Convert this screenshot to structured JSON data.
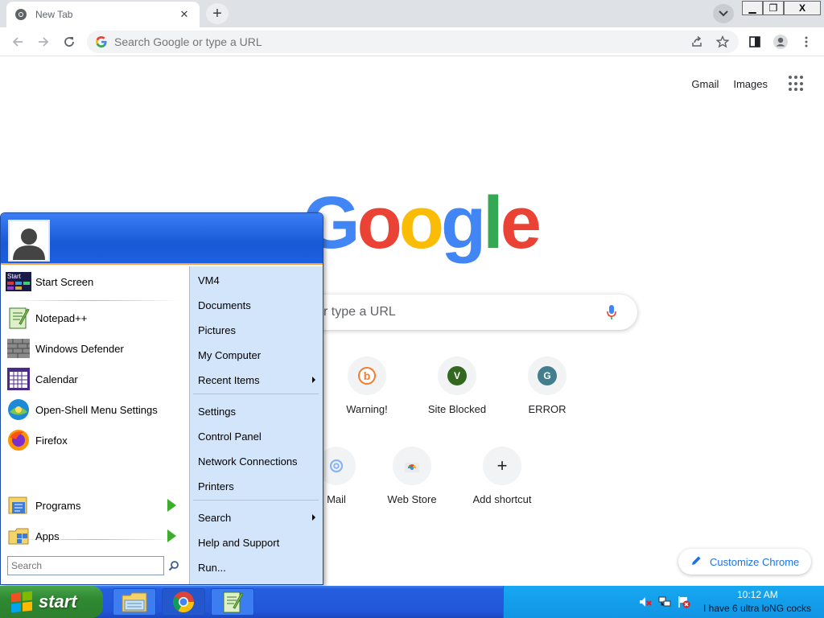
{
  "browser": {
    "tab_title": "New Tab",
    "omnibox_placeholder": "Search Google or type a URL",
    "window_controls": {
      "minimize": "▁",
      "maximize": "❐",
      "close": "X"
    }
  },
  "ntp": {
    "links": {
      "gmail": "Gmail",
      "images": "Images"
    },
    "logo": [
      "G",
      "o",
      "o",
      "g",
      "l",
      "e"
    ],
    "search_placeholder_visible": "r type a URL",
    "shortcuts": [
      {
        "label": "Warning!",
        "letter": "",
        "color": "#f47b2d"
      },
      {
        "label": "Site Blocked",
        "letter": "V",
        "color": "#33691e"
      },
      {
        "label": "ERROR",
        "letter": "G",
        "color": "#437e8f"
      },
      {
        "label": "Mail",
        "letter": "",
        "color": "#8ab4f8"
      },
      {
        "label": "Web Store",
        "letter": "",
        "color": "#ea4335"
      },
      {
        "label": "Add shortcut",
        "letter": "+",
        "color": "#202124"
      }
    ],
    "customize_label": "Customize Chrome",
    "accent": "#1a73e8"
  },
  "start_menu": {
    "left_items": {
      "start_screen": "Start Screen",
      "notepad": "Notepad++",
      "defender": "Windows Defender",
      "calendar": "Calendar",
      "openshell": "Open-Shell Menu Settings",
      "firefox": "Firefox",
      "programs": "Programs",
      "apps": "Apps"
    },
    "start_screen_badge": "Start",
    "search_placeholder": "Search",
    "right_items": {
      "vm4": "VM4",
      "documents": "Documents",
      "pictures": "Pictures",
      "my_computer": "My Computer",
      "recent_items": "Recent Items",
      "settings": "Settings",
      "control_panel": "Control Panel",
      "network": "Network Connections",
      "printers": "Printers",
      "search": "Search",
      "help": "Help and Support",
      "run": "Run..."
    }
  },
  "taskbar": {
    "start_label": "start",
    "clock_time": "10:12 AM",
    "clock_message": "I have 6 ultra loNG cocks"
  }
}
